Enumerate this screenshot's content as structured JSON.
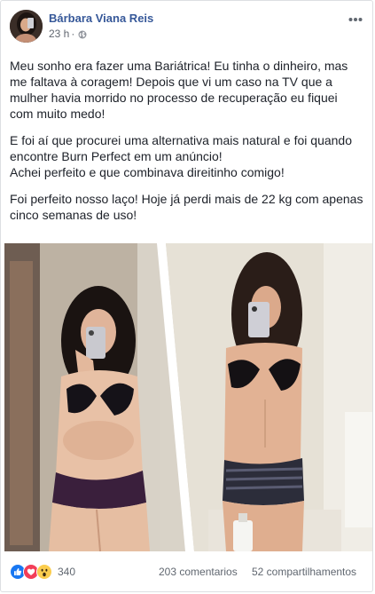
{
  "post": {
    "author_name": "Bárbara Viana Reis",
    "timestamp": "23 h",
    "separator": "·",
    "privacy_icon": "globe-icon",
    "more_icon": "more-horizontal-icon",
    "paragraphs": [
      {
        "lines": [
          "Meu sonho era fazer uma Bariátrica! Eu tinha o dinheiro, mas",
          "me faltava à coragem! Depois que vi um caso na TV que a",
          "mulher havia morrido no processo de recuperação eu fiquei",
          "com muito medo!"
        ]
      },
      {
        "lines": [
          "E foi aí que procurei uma alternativa mais natural e foi quando",
          "encontre Burn Perfect em um anúncio!",
          "Achei perfeito e que combinava direitinho comigo!"
        ]
      },
      {
        "lines": [
          "Foi perfeito nosso laço! Hoje já perdi mais de 22 kg com apenas",
          "cinco semanas de uso!"
        ]
      }
    ]
  },
  "footer": {
    "reaction_icons": [
      "like-icon",
      "love-icon",
      "wow-icon"
    ],
    "reaction_count": "340",
    "comments": "203 comentarios",
    "shares": "52 compartilhamentos"
  },
  "colors": {
    "name": "#365899",
    "meta": "#616770",
    "text": "#1d2129",
    "like": "#1877f2",
    "love": "#f33e58",
    "wow": "#fbcd4e",
    "border": "#dddfe2"
  }
}
